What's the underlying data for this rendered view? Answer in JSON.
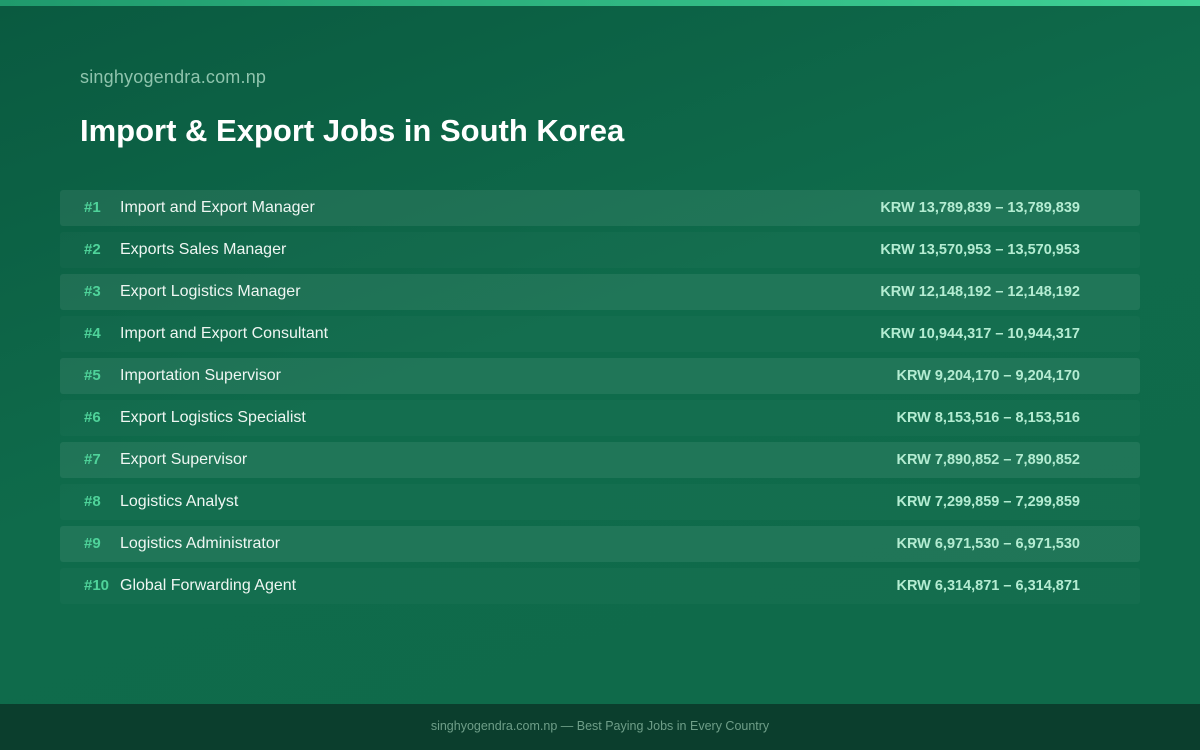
{
  "header": {
    "site_name": "singhyogendra.com.np",
    "title": "Import & Export Jobs in South Korea"
  },
  "jobs": [
    {
      "rank": "#1",
      "title": "Import and Export Manager",
      "salary": "KRW 13,789,839 – 13,789,839"
    },
    {
      "rank": "#2",
      "title": "Exports Sales Manager",
      "salary": "KRW 13,570,953 – 13,570,953"
    },
    {
      "rank": "#3",
      "title": "Export Logistics Manager",
      "salary": "KRW 12,148,192 – 12,148,192"
    },
    {
      "rank": "#4",
      "title": "Import and Export Consultant",
      "salary": "KRW 10,944,317 – 10,944,317"
    },
    {
      "rank": "#5",
      "title": "Importation Supervisor",
      "salary": "KRW 9,204,170 – 9,204,170"
    },
    {
      "rank": "#6",
      "title": "Export Logistics Specialist",
      "salary": "KRW 8,153,516 – 8,153,516"
    },
    {
      "rank": "#7",
      "title": "Export Supervisor",
      "salary": "KRW 7,890,852 – 7,890,852"
    },
    {
      "rank": "#8",
      "title": "Logistics Analyst",
      "salary": "KRW 7,299,859 – 7,299,859"
    },
    {
      "rank": "#9",
      "title": "Logistics Administrator",
      "salary": "KRW 6,971,530 – 6,971,530"
    },
    {
      "rank": "#10",
      "title": "Global Forwarding Agent",
      "salary": "KRW 6,314,871 – 6,314,871"
    }
  ],
  "footer": {
    "text": "singhyogendra.com.np — Best Paying Jobs in Every Country"
  },
  "colors": {
    "background": "#0f6a4a",
    "accent": "#3fd296",
    "rank": "#4fd39a",
    "salary": "#b4ecd2",
    "footer_bg": "#0b3e2d"
  }
}
